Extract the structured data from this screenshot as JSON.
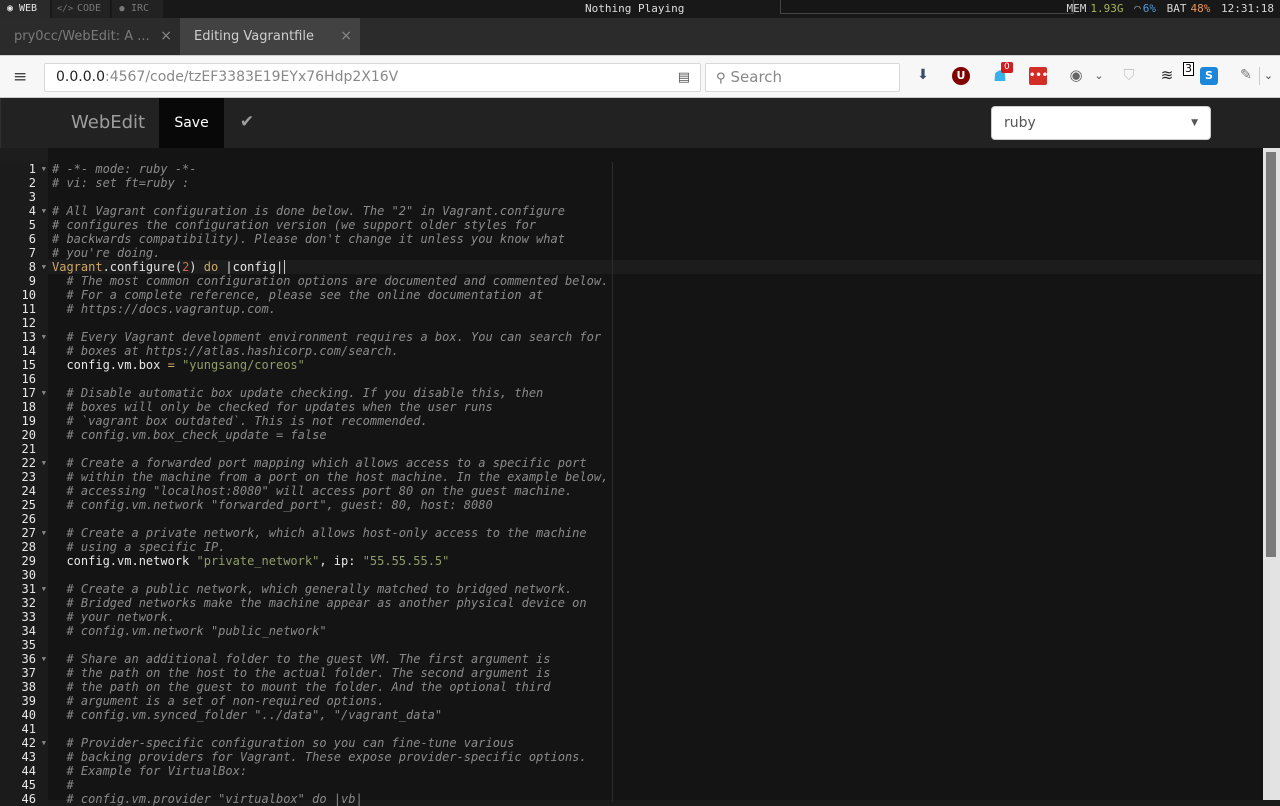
{
  "system_bar": {
    "workspaces": [
      {
        "icon": "globe-icon",
        "glyph": "◉",
        "label": "WEB",
        "active": true
      },
      {
        "icon": "code-icon",
        "glyph": "</>",
        "label": "CODE",
        "active": false
      },
      {
        "icon": "chat-icon",
        "glyph": "💬",
        "label": "IRC",
        "active": false
      }
    ],
    "now_playing": "Nothing Playing",
    "stats": {
      "mem_label": "MEM",
      "mem_value": "1.93G",
      "cpu_value": "6%",
      "bat_label": "BAT",
      "bat_value": "48%",
      "clock": "12:31:18"
    },
    "colors": {
      "mem": "#a7b556",
      "cpu": "#4a9de0",
      "bat": "#e9955a"
    }
  },
  "browser": {
    "tabs": [
      {
        "title": "pry0cc/WebEdit: A ...",
        "active": false,
        "close": "×"
      },
      {
        "title": "Editing Vagrantfile",
        "active": true,
        "close": "×"
      }
    ],
    "url": {
      "host": "0.0.0.0",
      "path": ":4567/code/tzEF3383E19EYx76Hdp2X16V"
    },
    "search_placeholder": "Search",
    "toolbar": {
      "ghostery_count": "0",
      "badge_count": "3"
    }
  },
  "app": {
    "brand": "WebEdit",
    "save_label": "Save",
    "check_glyph": "✔",
    "language": "ruby",
    "accent_colors": {
      "save_bg": "#080808",
      "header_bg": "#222222"
    }
  },
  "editor": {
    "active_line": 8,
    "fold_lines": [
      1,
      4,
      8,
      13,
      17,
      22,
      27,
      31,
      36,
      42
    ],
    "lines": [
      [
        [
          "comment",
          "# -*- mode: ruby -*-"
        ]
      ],
      [
        [
          "comment",
          "# vi: set ft=ruby :"
        ]
      ],
      [],
      [
        [
          "comment",
          "# All Vagrant configuration is done below. The \"2\" in Vagrant.configure"
        ]
      ],
      [
        [
          "comment",
          "# configures the configuration version (we support older styles for"
        ]
      ],
      [
        [
          "comment",
          "# backwards compatibility). Please don't change it unless you know what"
        ]
      ],
      [
        [
          "comment",
          "# you're doing."
        ]
      ],
      [
        [
          "const",
          "Vagrant"
        ],
        [
          "fn",
          ".configure("
        ],
        [
          "num",
          "2"
        ],
        [
          "fn",
          ") "
        ],
        [
          "kw",
          "do"
        ],
        [
          "plain",
          " |config|"
        ]
      ],
      [
        [
          "plain",
          "  "
        ],
        [
          "comment",
          "# The most common configuration options are documented and commented below."
        ]
      ],
      [
        [
          "plain",
          "  "
        ],
        [
          "comment",
          "# For a complete reference, please see the online documentation at"
        ]
      ],
      [
        [
          "plain",
          "  "
        ],
        [
          "comment",
          "# https://docs.vagrantup.com."
        ]
      ],
      [],
      [
        [
          "plain",
          "  "
        ],
        [
          "comment",
          "# Every Vagrant development environment requires a box. You can search for"
        ]
      ],
      [
        [
          "plain",
          "  "
        ],
        [
          "comment",
          "# boxes at https://atlas.hashicorp.com/search."
        ]
      ],
      [
        [
          "plain",
          "  config.vm.box "
        ],
        [
          "op",
          "="
        ],
        [
          "plain",
          " "
        ],
        [
          "str",
          "\"yungsang/coreos\""
        ]
      ],
      [],
      [
        [
          "plain",
          "  "
        ],
        [
          "comment",
          "# Disable automatic box update checking. If you disable this, then"
        ]
      ],
      [
        [
          "plain",
          "  "
        ],
        [
          "comment",
          "# boxes will only be checked for updates when the user runs"
        ]
      ],
      [
        [
          "plain",
          "  "
        ],
        [
          "comment",
          "# `vagrant box outdated`. This is not recommended."
        ]
      ],
      [
        [
          "plain",
          "  "
        ],
        [
          "comment",
          "# config.vm.box_check_update = false"
        ]
      ],
      [],
      [
        [
          "plain",
          "  "
        ],
        [
          "comment",
          "# Create a forwarded port mapping which allows access to a specific port"
        ]
      ],
      [
        [
          "plain",
          "  "
        ],
        [
          "comment",
          "# within the machine from a port on the host machine. In the example below,"
        ]
      ],
      [
        [
          "plain",
          "  "
        ],
        [
          "comment",
          "# accessing \"localhost:8080\" will access port 80 on the guest machine."
        ]
      ],
      [
        [
          "plain",
          "  "
        ],
        [
          "comment",
          "# config.vm.network \"forwarded_port\", guest: 80, host: 8080"
        ]
      ],
      [],
      [
        [
          "plain",
          "  "
        ],
        [
          "comment",
          "# Create a private network, which allows host-only access to the machine"
        ]
      ],
      [
        [
          "plain",
          "  "
        ],
        [
          "comment",
          "# using a specific IP."
        ]
      ],
      [
        [
          "plain",
          "  config.vm.network "
        ],
        [
          "str",
          "\"private_network\""
        ],
        [
          "plain",
          ", ip: "
        ],
        [
          "str",
          "\"55.55.55.5\""
        ]
      ],
      [],
      [
        [
          "plain",
          "  "
        ],
        [
          "comment",
          "# Create a public network, which generally matched to bridged network."
        ]
      ],
      [
        [
          "plain",
          "  "
        ],
        [
          "comment",
          "# Bridged networks make the machine appear as another physical device on"
        ]
      ],
      [
        [
          "plain",
          "  "
        ],
        [
          "comment",
          "# your network."
        ]
      ],
      [
        [
          "plain",
          "  "
        ],
        [
          "comment",
          "# config.vm.network \"public_network\""
        ]
      ],
      [],
      [
        [
          "plain",
          "  "
        ],
        [
          "comment",
          "# Share an additional folder to the guest VM. The first argument is"
        ]
      ],
      [
        [
          "plain",
          "  "
        ],
        [
          "comment",
          "# the path on the host to the actual folder. The second argument is"
        ]
      ],
      [
        [
          "plain",
          "  "
        ],
        [
          "comment",
          "# the path on the guest to mount the folder. And the optional third"
        ]
      ],
      [
        [
          "plain",
          "  "
        ],
        [
          "comment",
          "# argument is a set of non-required options."
        ]
      ],
      [
        [
          "plain",
          "  "
        ],
        [
          "comment",
          "# config.vm.synced_folder \"../data\", \"/vagrant_data\""
        ]
      ],
      [],
      [
        [
          "plain",
          "  "
        ],
        [
          "comment",
          "# Provider-specific configuration so you can fine-tune various"
        ]
      ],
      [
        [
          "plain",
          "  "
        ],
        [
          "comment",
          "# backing providers for Vagrant. These expose provider-specific options."
        ]
      ],
      [
        [
          "plain",
          "  "
        ],
        [
          "comment",
          "# Example for VirtualBox:"
        ]
      ],
      [
        [
          "plain",
          "  "
        ],
        [
          "comment",
          "#"
        ]
      ],
      [
        [
          "plain",
          "  "
        ],
        [
          "comment",
          "# config.vm.provider \"virtualbox\" do |vb|"
        ]
      ]
    ]
  }
}
